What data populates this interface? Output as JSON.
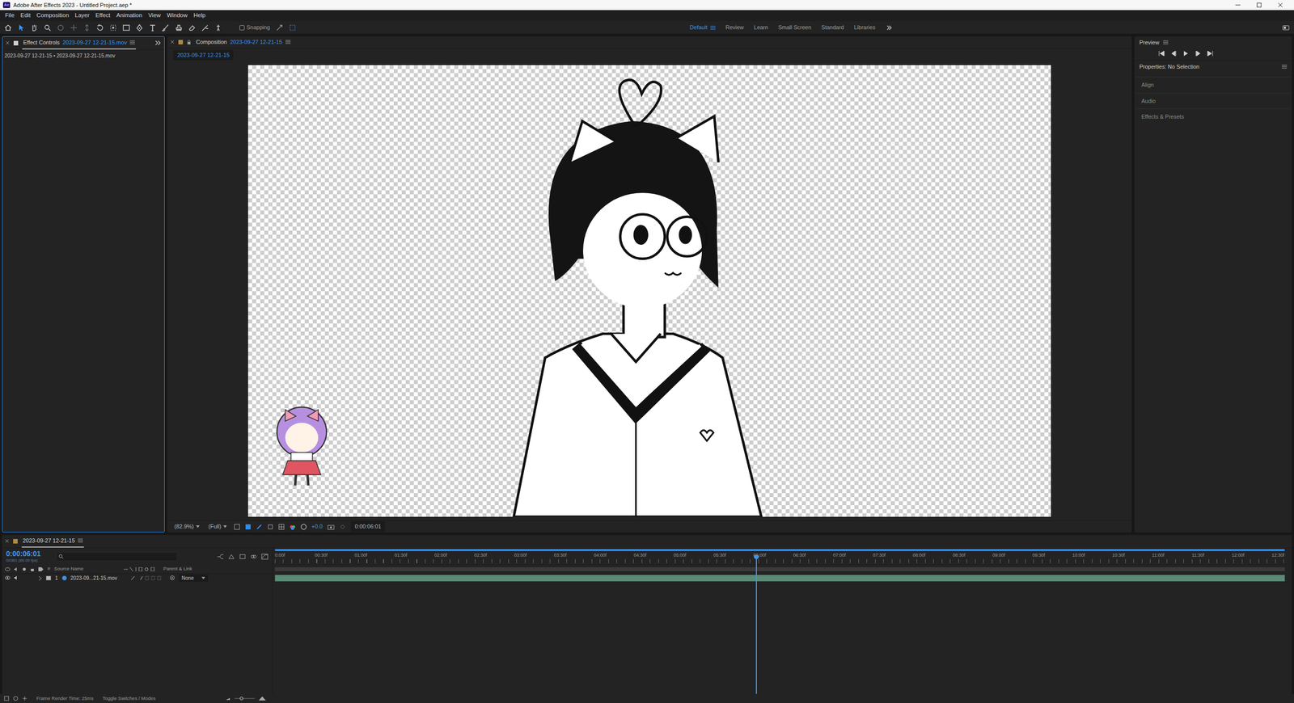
{
  "window": {
    "logo": "Ae",
    "title": "Adobe After Effects 2023 - Untitled Project.aep *"
  },
  "menu": [
    "File",
    "Edit",
    "Composition",
    "Layer",
    "Effect",
    "Animation",
    "View",
    "Window",
    "Help"
  ],
  "toolbar": {
    "snapping": {
      "label": "Snapping",
      "checked": false
    },
    "workspaces": [
      {
        "label": "Default",
        "selected": true
      },
      {
        "label": "Review",
        "selected": false
      },
      {
        "label": "Learn",
        "selected": false
      },
      {
        "label": "Small Screen",
        "selected": false
      },
      {
        "label": "Standard",
        "selected": false
      },
      {
        "label": "Libraries",
        "selected": false
      }
    ]
  },
  "effect_controls": {
    "tab_label": "Effect Controls",
    "tab_source": "2023-09-27 12-21-15.mov",
    "subtitle": "2023-09-27 12-21-15 • 2023-09-27 12-21-15.mov"
  },
  "composition": {
    "tab_label": "Composition",
    "tab_name": "2023-09-27 12-21-15",
    "subtab": "2023-09-27 12-21-15",
    "footer": {
      "zoom": "(82.9%)",
      "resolution": "(Full)",
      "exposure": "+0.0",
      "timecode": "0:00:06:01"
    }
  },
  "preview": {
    "title": "Preview"
  },
  "properties": {
    "title": "Properties: No Selection",
    "sections": [
      "Align",
      "Audio",
      "Effects & Presets"
    ]
  },
  "timeline": {
    "tab": "2023-09-27 12-21-15",
    "timecode": "0:00:06:01",
    "frame_info": "00361 (60.00 fps)",
    "columns": {
      "index": "#",
      "source": "Source Name",
      "parent": "Parent & Link"
    },
    "layers": [
      {
        "index": "1",
        "name": "2023-09...21-15.mov",
        "parent": "None",
        "expanded": false,
        "selected": false
      }
    ],
    "ruler": [
      "0:00f",
      "00:30f",
      "01:00f",
      "01:30f",
      "02:00f",
      "02:30f",
      "03:00f",
      "03:30f",
      "04:00f",
      "04:30f",
      "05:00f",
      "05:30f",
      "06:00f",
      "06:30f",
      "07:00f",
      "07:30f",
      "08:00f",
      "08:30f",
      "09:00f",
      "09:30f",
      "10:00f",
      "10:30f",
      "11:00f",
      "11:30f",
      "12:00f",
      "12:30f"
    ],
    "playhead": {
      "level": 0.476
    }
  },
  "status_bar": {
    "render_time": "Frame Render Time: 25ms",
    "toggle": "Toggle Switches / Modes"
  }
}
